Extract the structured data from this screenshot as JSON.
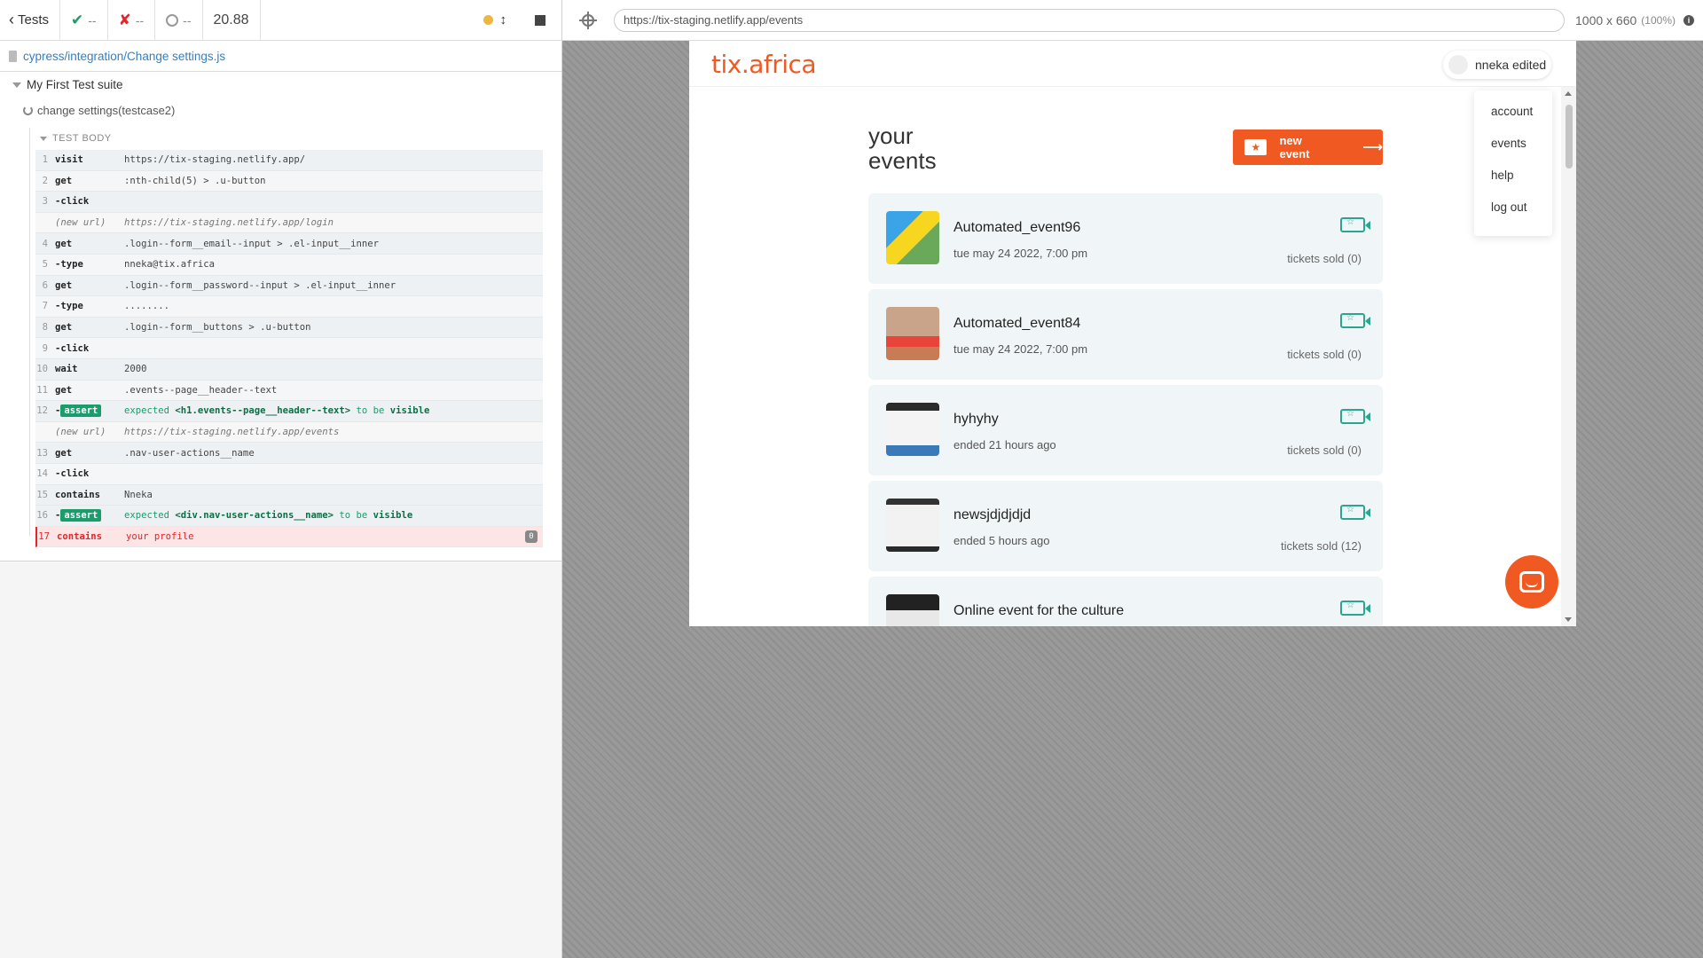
{
  "reporter": {
    "header": {
      "tests_label": "Tests",
      "passed": "--",
      "failed": "--",
      "pending": "--",
      "duration": "20.88"
    },
    "spec_path": "cypress/integration/Change settings.js",
    "suite_title": "My First Test suite",
    "test_title": "change settings(testcase2)",
    "test_body_label": "TEST BODY",
    "commands": [
      {
        "num": "1",
        "name": "visit",
        "message": "https://tix-staging.netlify.app/",
        "kind": "normal"
      },
      {
        "num": "2",
        "name": "get",
        "message": ":nth-child(5) > .u-button",
        "kind": "normal"
      },
      {
        "num": "3",
        "name": " -click",
        "message": "",
        "kind": "normal"
      },
      {
        "num": "",
        "name": "(new url)",
        "message": "https://tix-staging.netlify.app/login",
        "kind": "newurl"
      },
      {
        "num": "4",
        "name": "get",
        "message": ".login--form__email--input > .el-input__inner",
        "kind": "normal"
      },
      {
        "num": "5",
        "name": " -type",
        "message": "nneka@tix.africa",
        "kind": "normal"
      },
      {
        "num": "6",
        "name": "get",
        "message": ".login--form__password--input > .el-input__inner",
        "kind": "normal"
      },
      {
        "num": "7",
        "name": " -type",
        "message": "........",
        "kind": "normal"
      },
      {
        "num": "8",
        "name": "get",
        "message": ".login--form__buttons > .u-button",
        "kind": "normal"
      },
      {
        "num": "9",
        "name": " -click",
        "message": "",
        "kind": "normal"
      },
      {
        "num": "10",
        "name": "wait",
        "message": "2000",
        "kind": "normal"
      },
      {
        "num": "11",
        "name": "get",
        "message": ".events--page__header--text",
        "kind": "normal"
      },
      {
        "num": "12",
        "name": "assert",
        "message_pre": "expected ",
        "message_el": "<h1.events--page__header--text>",
        "message_mid": " to be ",
        "message_end": "visible",
        "kind": "assert"
      },
      {
        "num": "",
        "name": "(new url)",
        "message": "https://tix-staging.netlify.app/events",
        "kind": "newurl"
      },
      {
        "num": "13",
        "name": "get",
        "message": ".nav-user-actions__name",
        "kind": "normal"
      },
      {
        "num": "14",
        "name": " -click",
        "message": "",
        "kind": "normal"
      },
      {
        "num": "15",
        "name": "contains",
        "message": "Nneka",
        "kind": "normal"
      },
      {
        "num": "16",
        "name": "assert",
        "message_pre": "expected ",
        "message_el": "<div.nav-user-actions__name>",
        "message_mid": " to be ",
        "message_end": "visible",
        "kind": "assert"
      },
      {
        "num": "17",
        "name": "contains",
        "message": "your profile",
        "kind": "failed",
        "badge": "0"
      }
    ]
  },
  "aut": {
    "url": "https://tix-staging.netlify.app/events",
    "viewport": "1000 x 660",
    "zoom": "(100%)",
    "info_icon": "i",
    "app": {
      "logo": "tix.africa",
      "user_name": "nneka edited",
      "page_title_line1": "your",
      "page_title_line2": "events",
      "new_event_label": "new event",
      "new_event_arrow": "⟶",
      "ticket_icon_glyph": "★",
      "dropdown": [
        "account",
        "events",
        "help",
        "log out"
      ],
      "camera_glyph": "☆",
      "events": [
        {
          "name": "Automated_event96",
          "date": "tue may 24 2022, 7:00 pm",
          "sold": "tickets sold (0)"
        },
        {
          "name": "Automated_event84",
          "date": "tue may 24 2022, 7:00 pm",
          "sold": "tickets sold (0)"
        },
        {
          "name": "hyhyhy",
          "date": "ended 21 hours ago",
          "sold": "tickets sold (0)"
        },
        {
          "name": "newsjdjdjdjd",
          "date": "ended 5 hours ago",
          "sold": "tickets sold (12)"
        },
        {
          "name": "Online event for the culture",
          "date": "",
          "sold": ""
        }
      ]
    }
  },
  "colors": {
    "brand": "#f05a22",
    "passed": "#1a9c6b",
    "failed": "#e0262b",
    "link": "#3380c4",
    "teal": "#2aa58f"
  },
  "icons": [
    "chevron-left-icon",
    "check-icon",
    "x-icon",
    "pending-circle-icon",
    "status-dot-icon",
    "scroll-arrows-icon",
    "stop-icon",
    "file-icon",
    "crosshair-icon",
    "info-icon",
    "ticket-icon",
    "camera-icon",
    "chat-icon"
  ]
}
